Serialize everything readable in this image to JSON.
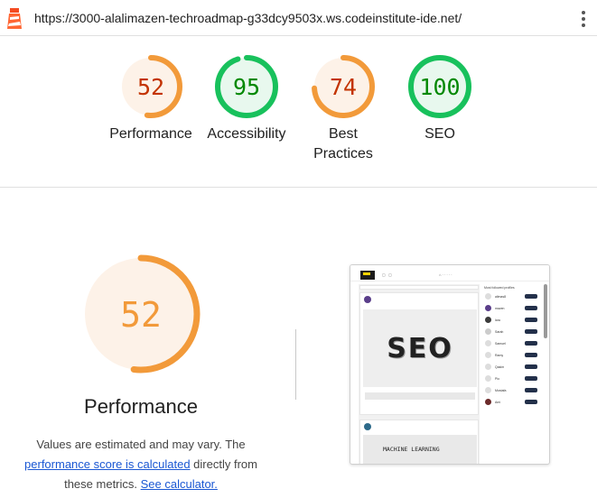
{
  "browser": {
    "url": "https://3000-alalimazen-techroadmap-g33dcy9503x.ws.codeinstitute-ide.net/"
  },
  "summary": [
    {
      "score": "52",
      "label": "Performance",
      "value": 0.52,
      "color": "#f29a3a",
      "text_color": "#c33300",
      "fill": "#fdf2e8"
    },
    {
      "score": "95",
      "label": "Accessibility",
      "value": 0.95,
      "color": "#18c15c",
      "text_color": "#008800",
      "fill": "#e8f8ee"
    },
    {
      "score": "74",
      "label": "Best Practices",
      "value": 0.74,
      "color": "#f29a3a",
      "text_color": "#c33300",
      "fill": "#fdf2e8"
    },
    {
      "score": "100",
      "label": "SEO",
      "value": 1.0,
      "color": "#18c15c",
      "text_color": "#008800",
      "fill": "#e8f8ee"
    }
  ],
  "performance": {
    "score": "52",
    "value": 0.52,
    "title": "Performance",
    "desc_part1": "Values are estimated and may vary. The",
    "link_score": "performance score is calculated",
    "desc_part2": " directly from these metrics. ",
    "link_calc": "See calculator."
  },
  "thumbnail": {
    "seo_word": "SEO",
    "caption": "MACHINE LEARNING",
    "sidebar_title": "Most followed profiles",
    "sidebar_names": [
      "alimas8",
      "mazen",
      "lara",
      "Sarah",
      "Samuel",
      "Ramy",
      "Qasim",
      "Pio",
      "Mostafa",
      "Ami"
    ]
  },
  "colors": {
    "orange": "#f29a3a",
    "green": "#18c15c",
    "link": "#1a57d3"
  }
}
